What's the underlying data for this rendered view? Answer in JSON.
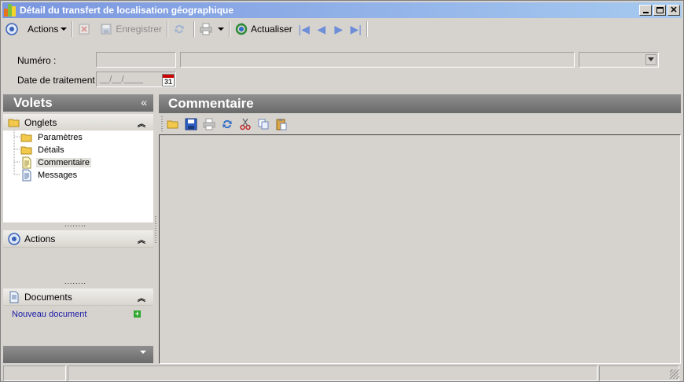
{
  "window": {
    "title": "Détail du transfert de localisation géographique",
    "controls": [
      "minimize",
      "maximize",
      "close"
    ]
  },
  "toolbar": {
    "actions_label": "Actions",
    "save_label": "Enregistrer",
    "refresh_label": "Actualiser"
  },
  "form": {
    "numero_label": "Numéro :",
    "numero_value": "",
    "numero_desc": "",
    "numero_combo": "",
    "date_label": "Date de traitement :",
    "date_placeholder": "__/__/____",
    "calendar_day": "31"
  },
  "left_panel": {
    "title": "Volets",
    "collapse_glyph": "«",
    "sections": {
      "onglets": {
        "label": "Onglets",
        "items": [
          "Paramètres",
          "Détails",
          "Commentaire",
          "Messages"
        ],
        "selected": "Commentaire"
      },
      "actions": {
        "label": "Actions"
      },
      "documents": {
        "label": "Documents",
        "new_document_label": "Nouveau document"
      }
    }
  },
  "right_panel": {
    "title": "Commentaire",
    "tools": [
      "open-folder-icon",
      "save-icon",
      "print-icon",
      "refresh-icon",
      "cut-icon",
      "copy-icon",
      "paste-icon"
    ]
  },
  "status_bar": {
    "segments": [
      "",
      "",
      ""
    ]
  },
  "colors": {
    "titlebar_start": "#7a96df",
    "titlebar_end": "#a6caf0",
    "panel_header": "#6a6a6a",
    "window_bg": "#d6d3ce",
    "link": "#1a1aa6"
  }
}
